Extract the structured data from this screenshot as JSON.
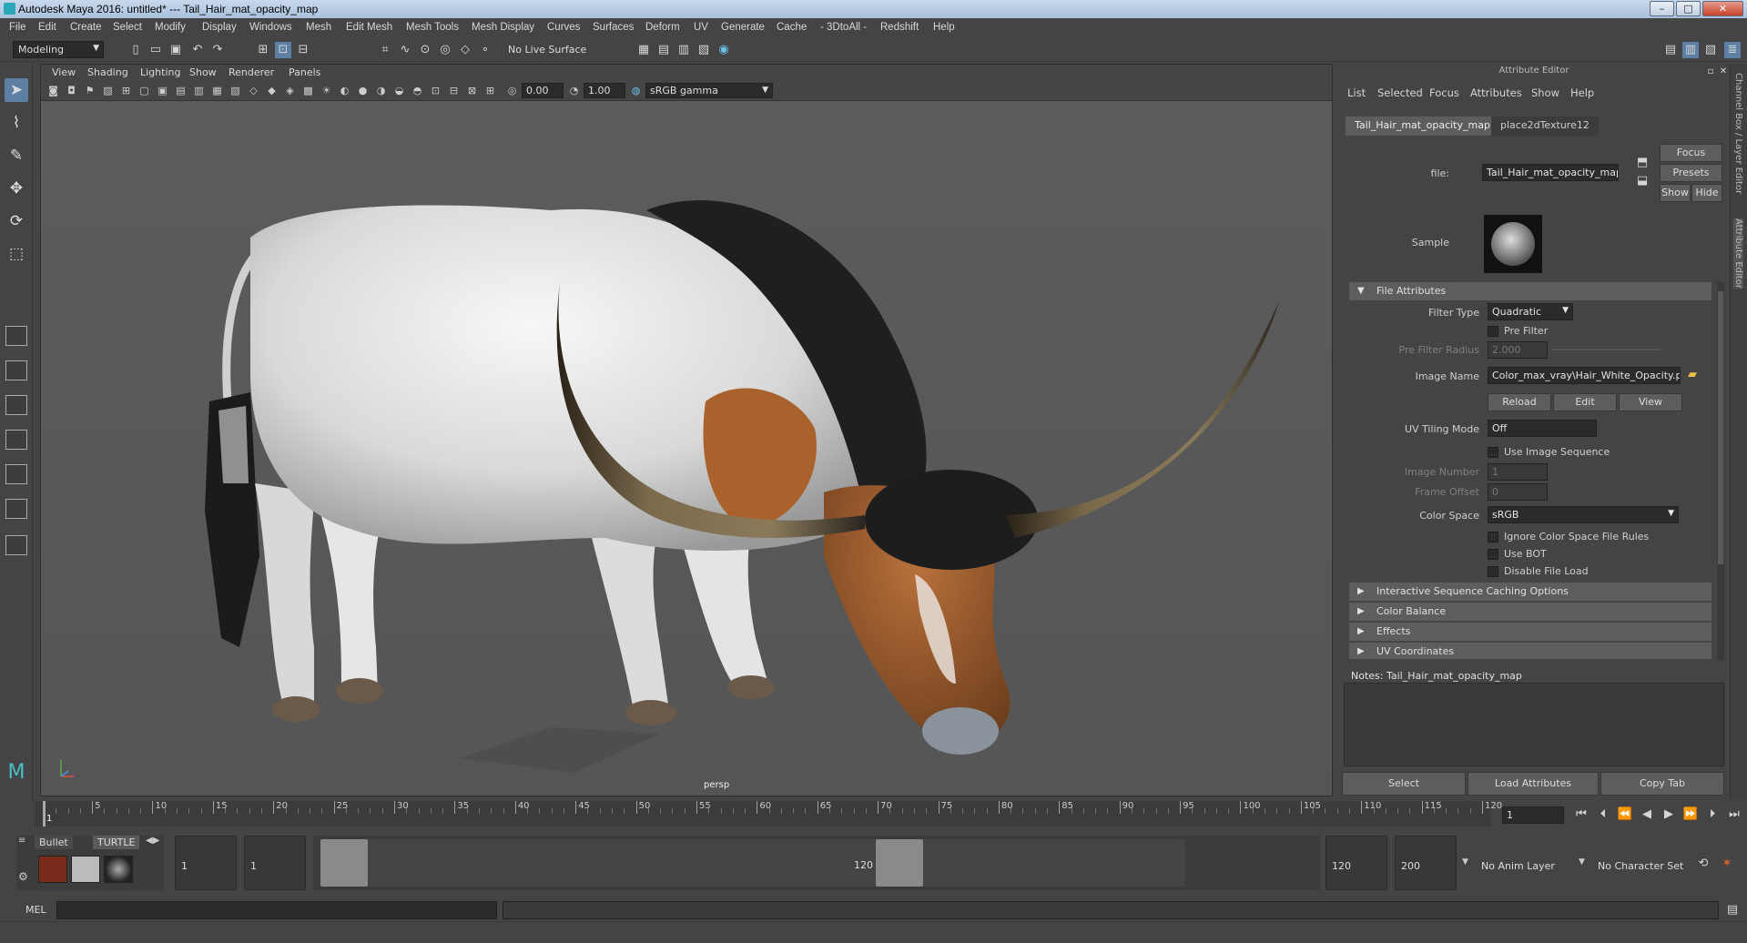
{
  "window": {
    "title": "Autodesk Maya 2016: untitled*   ---   Tail_Hair_mat_opacity_map",
    "minimize": "–",
    "maximize": "□",
    "close": "✕"
  },
  "menubar": [
    "File",
    "Edit",
    "Create",
    "Select",
    "Modify",
    "Display",
    "Windows",
    "Mesh",
    "Edit Mesh",
    "Mesh Tools",
    "Mesh Display",
    "Curves",
    "Surfaces",
    "Deform",
    "UV",
    "Generate",
    "Cache",
    "- 3DtoAll -",
    "Redshift",
    "Help"
  ],
  "statusline": {
    "workspace": "Modeling",
    "live_surface": "No Live Surface"
  },
  "viewport": {
    "menu": [
      "View",
      "Shading",
      "Lighting",
      "Show",
      "Renderer",
      "Panels"
    ],
    "exposure": "0.00",
    "gamma": "1.00",
    "color_space": "sRGB gamma",
    "camera_label": "persp"
  },
  "attribute_editor": {
    "title": "Attribute Editor",
    "menu": [
      "List",
      "Selected",
      "Focus",
      "Attributes",
      "Show",
      "Help"
    ],
    "tabs": [
      "Tail_Hair_mat_opacity_map",
      "place2dTexture12"
    ],
    "file_label": "file:",
    "file_value": "Tail_Hair_mat_opacity_map",
    "buttons": {
      "focus": "Focus",
      "presets": "Presets",
      "show": "Show",
      "hide": "Hide"
    },
    "sample_label": "Sample",
    "sections": {
      "file_attributes": "File Attributes",
      "interactive": "Interactive Sequence Caching Options",
      "color_balance": "Color Balance",
      "effects": "Effects",
      "uv_coords": "UV Coordinates"
    },
    "filter_type_label": "Filter Type",
    "filter_type_value": "Quadratic",
    "pre_filter": "Pre Filter",
    "pre_filter_radius_label": "Pre Filter Radius",
    "pre_filter_radius_value": "2.000",
    "image_name_label": "Image Name",
    "image_name_value": "Color_max_vray\\Hair_White_Opacity.png",
    "reload": "Reload",
    "edit": "Edit",
    "view": "View",
    "uv_tiling_label": "UV Tiling Mode",
    "uv_tiling_value": "Off",
    "use_image_sequence": "Use Image Sequence",
    "image_number_label": "Image Number",
    "image_number_value": "1",
    "frame_offset_label": "Frame Offset",
    "frame_offset_value": "0",
    "color_space_label": "Color Space",
    "color_space_value": "sRGB",
    "ignore_rules": "Ignore Color Space File Rules",
    "use_bot": "Use BOT",
    "disable_file_load": "Disable File Load",
    "notes": "Notes:  Tail_Hair_mat_opacity_map",
    "bottom_buttons": [
      "Select",
      "Load Attributes",
      "Copy Tab"
    ],
    "side_tabs": [
      "Channel Box / Layer Editor",
      "Attribute Editor"
    ]
  },
  "timeslider": {
    "ticks": [
      1,
      5,
      10,
      15,
      20,
      25,
      30,
      35,
      40,
      45,
      50,
      55,
      60,
      65,
      70,
      75,
      80,
      85,
      90,
      95,
      100,
      105,
      110,
      115,
      120
    ],
    "current_frame": "1",
    "current_field": "1"
  },
  "rangeslider": {
    "shelf_tabs": [
      "Bullet",
      "TURTLE"
    ],
    "start": "1",
    "start_inner": "1",
    "range_start": "1",
    "range_end": "120",
    "end_inner": "120",
    "end": "200",
    "anim_layer": "No Anim Layer",
    "char_set": "No Character Set"
  },
  "cmdline": {
    "label": "MEL"
  }
}
